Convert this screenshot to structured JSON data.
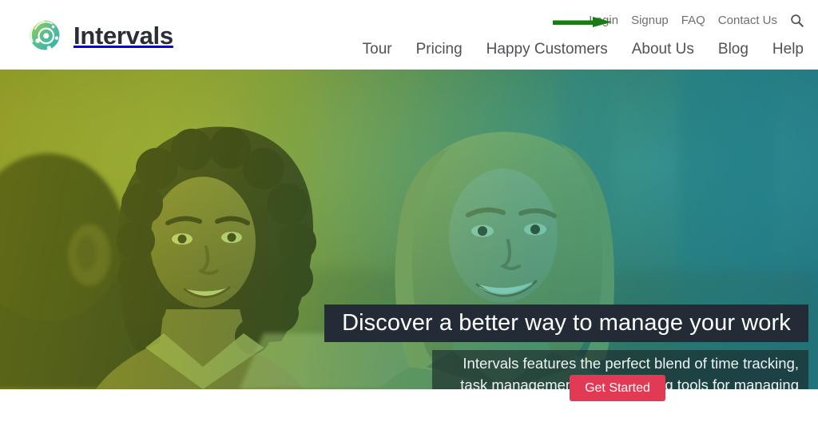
{
  "header": {
    "brand": {
      "name": "Intervals",
      "logo_icon": "intervals-orbit-logo",
      "logo_gradient_from": "#8cc63f",
      "logo_gradient_to": "#2bb3a3",
      "wordmark_color": "#2b2e38"
    },
    "utility_nav": [
      {
        "label": "Login"
      },
      {
        "label": "Signup"
      },
      {
        "label": "FAQ"
      },
      {
        "label": "Contact Us"
      }
    ],
    "search_icon": "search-icon",
    "main_nav": [
      {
        "label": "Tour"
      },
      {
        "label": "Pricing"
      },
      {
        "label": "Happy Customers"
      },
      {
        "label": "About Us"
      },
      {
        "label": "Blog"
      },
      {
        "label": "Help"
      }
    ]
  },
  "annotation": {
    "arrow_icon": "right-arrow-annotation",
    "arrow_color": "#1a7a14",
    "points_to": "Login"
  },
  "hero": {
    "headline": "Discover a better way to manage your work",
    "headline_bar_color": "#222b36",
    "subheading": "Intervals features the perfect blend of time tracking, task management, and reporting tools for managing your work, and your business, toward success.",
    "cta_label": "Get Started",
    "cta_color": "#e23a54",
    "duotone_left_color": "#a8c019",
    "duotone_right_color": "#1a8c98",
    "image_alt": "two-women-in-conversation-photo"
  }
}
